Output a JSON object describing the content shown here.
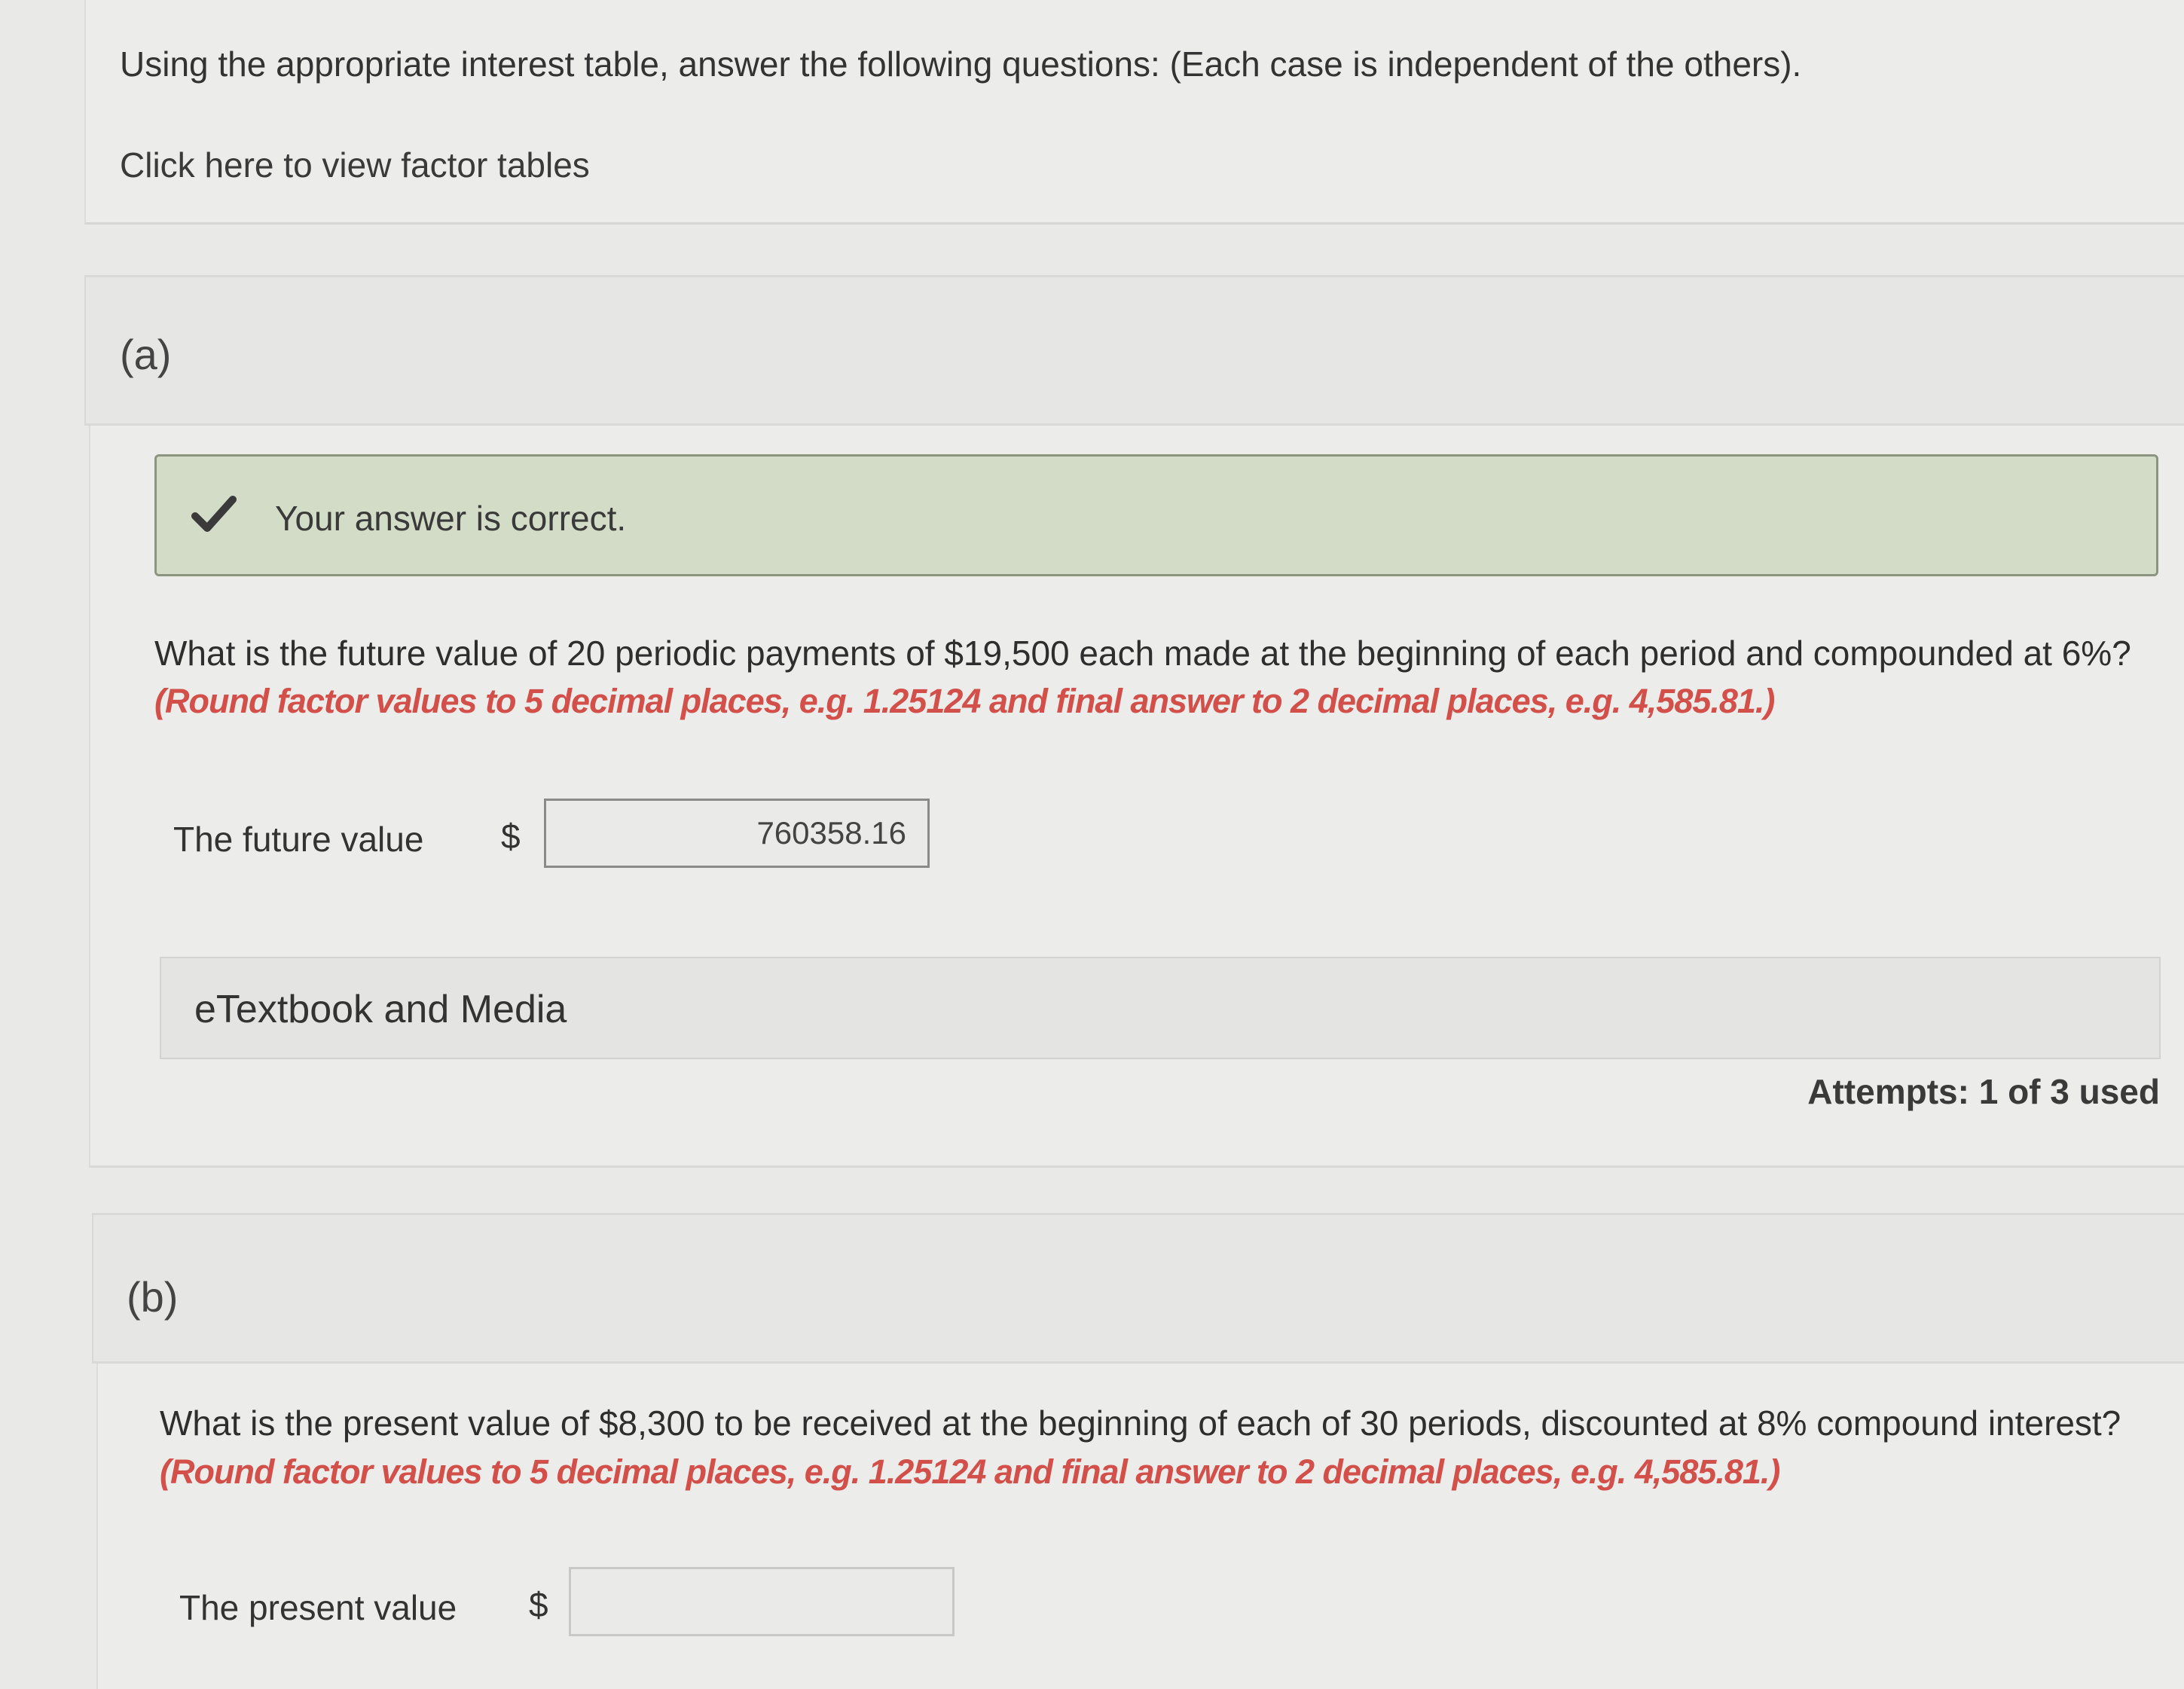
{
  "intro": {
    "text": "Using the appropriate interest table, answer the following questions: (Each case is independent of the others).",
    "factor_link": "Click here to view factor tables"
  },
  "part_a": {
    "label": "(a)",
    "feedback": "Your answer is correct.",
    "question": "What is the future value of 20 periodic payments of $19,500 each made at the beginning of each period and compounded at 6%?",
    "instruction": "(Round factor values to 5 decimal places, e.g. 1.25124 and final answer to 2 decimal places, e.g. 4,585.81.)",
    "field_label": "The future value",
    "currency": "$",
    "answer": "760358.16",
    "etextbook": "eTextbook and Media",
    "attempts": "Attempts: 1 of 3 used"
  },
  "part_b": {
    "label": "(b)",
    "question": "What is the present value of $8,300 to be received at the beginning of each of 30 periods, discounted at 8% compound interest?",
    "instruction": "(Round factor values to 5 decimal places, e.g. 1.25124 and final answer to 2 decimal places, e.g. 4,585.81.)",
    "field_label": "The present value",
    "currency": "$",
    "answer": ""
  },
  "colors": {
    "instruction": "#d3504a",
    "success_bg": "#d2dcc6",
    "success_border": "#8b9580",
    "check": "#3a3a3a"
  }
}
